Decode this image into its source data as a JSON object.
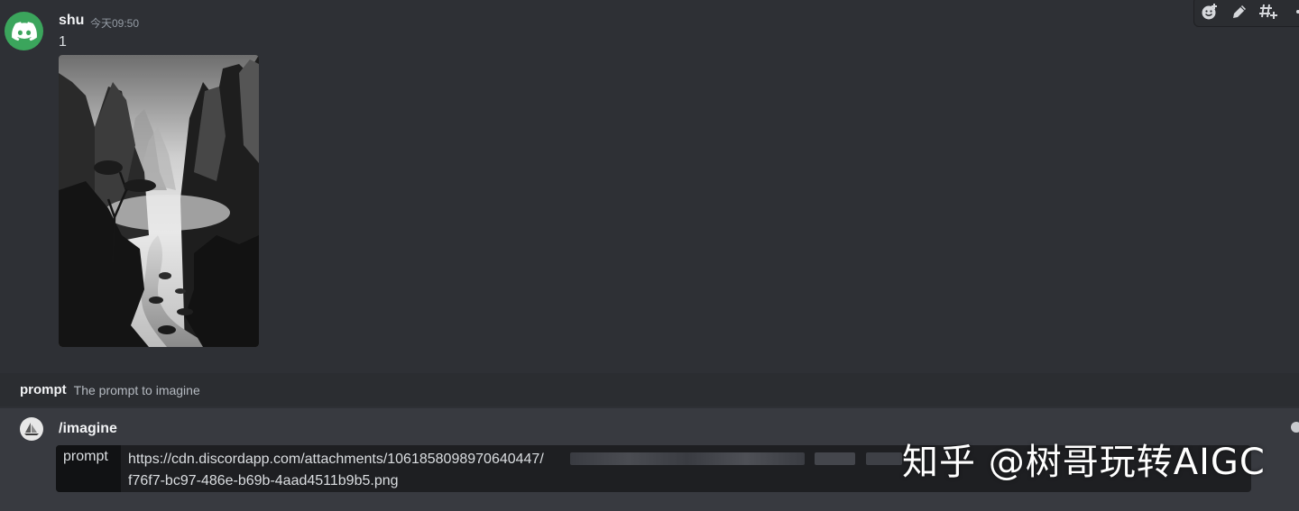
{
  "message": {
    "username": "shu",
    "timestamp": "今天09:50",
    "text": "1",
    "avatar_icon": "discord-logo-icon",
    "attachment_icon": "ink-wash-landscape-image"
  },
  "toolbar": {
    "icons": [
      "add-reaction-icon",
      "edit-icon",
      "create-thread-icon",
      "more-icon"
    ]
  },
  "prompt_hint": {
    "label": "prompt",
    "description": "The prompt to imagine"
  },
  "composer": {
    "command": "/imagine",
    "option_label": "prompt",
    "option_value": "https://cdn.discordapp.com/attachments/1061858098970640447/",
    "option_value_line2": "f76f7-bc97-486e-b69b-4aad4511b9b5.png"
  },
  "watermark": "知乎 @树哥玩转AIGC",
  "colors": {
    "background": "#2e3035",
    "composer": "#383a40",
    "avatar": "#3ba55c"
  }
}
